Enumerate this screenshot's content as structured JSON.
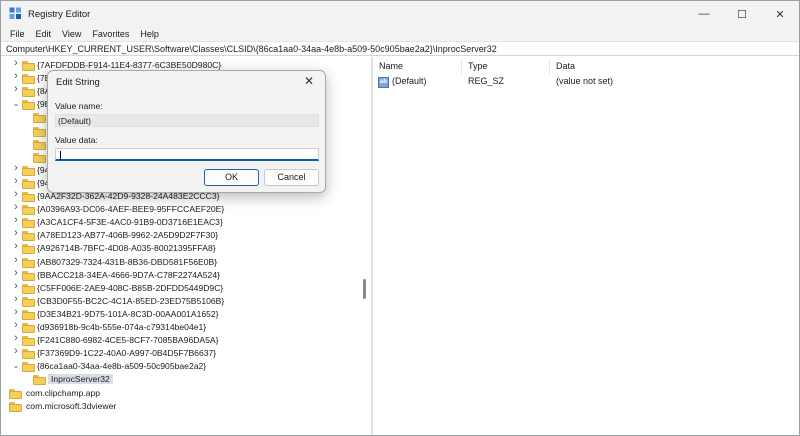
{
  "window": {
    "title": "Registry Editor",
    "minimize_glyph": "—",
    "maximize_glyph": "☐",
    "close_glyph": "✕"
  },
  "menu": [
    "File",
    "Edit",
    "View",
    "Favorites",
    "Help"
  ],
  "address": "Computer\\HKEY_CURRENT_USER\\Software\\Classes\\CLSID\\{86ca1aa0-34aa-4e8b-a509-50c905bae2a2}\\InprocServer32",
  "tree": {
    "items": [
      {
        "label": "{7AFDFDDB-F914-11E4-8377-6C3BE50D980C}",
        "chevron": "right",
        "indent": 0
      },
      {
        "label": "{7E",
        "chevron": "right",
        "indent": 0
      },
      {
        "label": "{8A",
        "chevron": "right",
        "indent": 0
      },
      {
        "label": "{9E",
        "chevron": "down",
        "indent": 0
      },
      {
        "label": "",
        "chevron": "",
        "indent": 1
      },
      {
        "label": "",
        "chevron": "",
        "indent": 1
      },
      {
        "label": "",
        "chevron": "",
        "indent": 1
      },
      {
        "label": "",
        "chevron": "",
        "indent": 1
      },
      {
        "label": "{94",
        "chevron": "right",
        "indent": 0
      },
      {
        "label": "{94",
        "chevron": "right",
        "indent": 0
      },
      {
        "label": "{9AA2F32D-362A-42D9-9328-24A483E2CCC3}",
        "chevron": "right",
        "indent": 0
      },
      {
        "label": "{A0396A93-DC06-4AEF-BEE9-95FFCCAEF20E}",
        "chevron": "right",
        "indent": 0
      },
      {
        "label": "{A3CA1CF4-5F3E-4AC0-91B9-0D3716E1EAC3}",
        "chevron": "right",
        "indent": 0
      },
      {
        "label": "{A78ED123-AB77-406B-9962-2A5D9D2F7F30}",
        "chevron": "right",
        "indent": 0
      },
      {
        "label": "{A926714B-7BFC-4D08-A035-80021395FFA8}",
        "chevron": "right",
        "indent": 0
      },
      {
        "label": "{AB807329-7324-431B-8B36-DBD581F56E0B}",
        "chevron": "right",
        "indent": 0
      },
      {
        "label": "{BBACC218-34EA-4666-9D7A-C78F2274A524}",
        "chevron": "right",
        "indent": 0
      },
      {
        "label": "{C5FF006E-2AE9-408C-B85B-2DFDD5449D9C}",
        "chevron": "right",
        "indent": 0
      },
      {
        "label": "{CB3D0F55-BC2C-4C1A-85ED-23ED75B5106B}",
        "chevron": "right",
        "indent": 0
      },
      {
        "label": "{D3E34B21-9D75-101A-8C3D-00AA001A1652}",
        "chevron": "right",
        "indent": 0
      },
      {
        "label": "{d936918b-9c4b-555e-074a-c79314be04e1}",
        "chevron": "right",
        "indent": 0
      },
      {
        "label": "{F241C880-6982-4CE5-8CF7-7085BA96DA5A}",
        "chevron": "right",
        "indent": 0
      },
      {
        "label": "{F37369D9-1C22-40A0-A997-0B4D5F7B6637}",
        "chevron": "right",
        "indent": 0
      },
      {
        "label": "{86ca1aa0-34aa-4e8b-a509-50c905bae2a2}",
        "chevron": "down",
        "indent": 0
      },
      {
        "label": "InprocServer32",
        "chevron": "",
        "indent": 1,
        "selected": true
      },
      {
        "label": "com.clipchamp.app",
        "chevron": "",
        "indent": -1
      },
      {
        "label": "com.microsoft.3dviewer",
        "chevron": "",
        "indent": -1
      }
    ]
  },
  "list": {
    "headers": {
      "name": "Name",
      "type": "Type",
      "data": "Data"
    },
    "rows": [
      {
        "icon": "ab",
        "name": "(Default)",
        "type": "REG_SZ",
        "data": "(value not set)"
      }
    ]
  },
  "dialog": {
    "title": "Edit String",
    "close_glyph": "✕",
    "value_name_label": "Value name:",
    "value_name": "(Default)",
    "value_data_label": "Value data:",
    "value_data": "",
    "ok_label": "OK",
    "cancel_label": "Cancel"
  }
}
